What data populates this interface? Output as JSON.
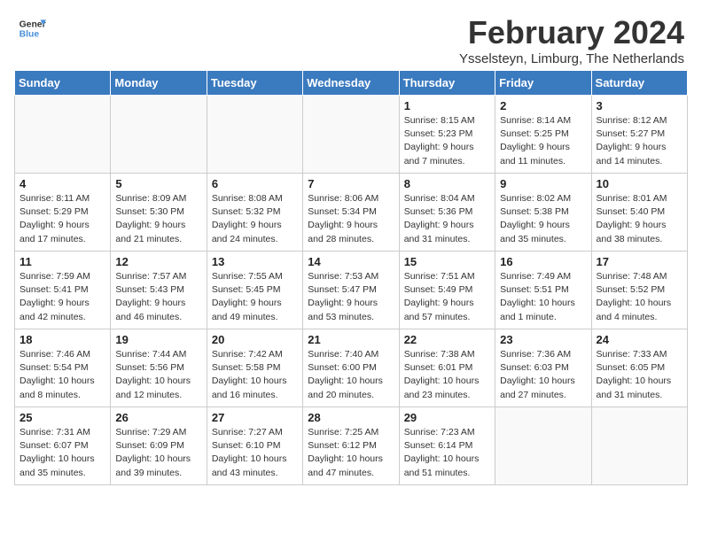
{
  "header": {
    "logo_general": "General",
    "logo_blue": "Blue",
    "month": "February 2024",
    "location": "Ysselsteyn, Limburg, The Netherlands"
  },
  "days_of_week": [
    "Sunday",
    "Monday",
    "Tuesday",
    "Wednesday",
    "Thursday",
    "Friday",
    "Saturday"
  ],
  "weeks": [
    [
      {
        "day": "",
        "info": ""
      },
      {
        "day": "",
        "info": ""
      },
      {
        "day": "",
        "info": ""
      },
      {
        "day": "",
        "info": ""
      },
      {
        "day": "1",
        "info": "Sunrise: 8:15 AM\nSunset: 5:23 PM\nDaylight: 9 hours\nand 7 minutes."
      },
      {
        "day": "2",
        "info": "Sunrise: 8:14 AM\nSunset: 5:25 PM\nDaylight: 9 hours\nand 11 minutes."
      },
      {
        "day": "3",
        "info": "Sunrise: 8:12 AM\nSunset: 5:27 PM\nDaylight: 9 hours\nand 14 minutes."
      }
    ],
    [
      {
        "day": "4",
        "info": "Sunrise: 8:11 AM\nSunset: 5:29 PM\nDaylight: 9 hours\nand 17 minutes."
      },
      {
        "day": "5",
        "info": "Sunrise: 8:09 AM\nSunset: 5:30 PM\nDaylight: 9 hours\nand 21 minutes."
      },
      {
        "day": "6",
        "info": "Sunrise: 8:08 AM\nSunset: 5:32 PM\nDaylight: 9 hours\nand 24 minutes."
      },
      {
        "day": "7",
        "info": "Sunrise: 8:06 AM\nSunset: 5:34 PM\nDaylight: 9 hours\nand 28 minutes."
      },
      {
        "day": "8",
        "info": "Sunrise: 8:04 AM\nSunset: 5:36 PM\nDaylight: 9 hours\nand 31 minutes."
      },
      {
        "day": "9",
        "info": "Sunrise: 8:02 AM\nSunset: 5:38 PM\nDaylight: 9 hours\nand 35 minutes."
      },
      {
        "day": "10",
        "info": "Sunrise: 8:01 AM\nSunset: 5:40 PM\nDaylight: 9 hours\nand 38 minutes."
      }
    ],
    [
      {
        "day": "11",
        "info": "Sunrise: 7:59 AM\nSunset: 5:41 PM\nDaylight: 9 hours\nand 42 minutes."
      },
      {
        "day": "12",
        "info": "Sunrise: 7:57 AM\nSunset: 5:43 PM\nDaylight: 9 hours\nand 46 minutes."
      },
      {
        "day": "13",
        "info": "Sunrise: 7:55 AM\nSunset: 5:45 PM\nDaylight: 9 hours\nand 49 minutes."
      },
      {
        "day": "14",
        "info": "Sunrise: 7:53 AM\nSunset: 5:47 PM\nDaylight: 9 hours\nand 53 minutes."
      },
      {
        "day": "15",
        "info": "Sunrise: 7:51 AM\nSunset: 5:49 PM\nDaylight: 9 hours\nand 57 minutes."
      },
      {
        "day": "16",
        "info": "Sunrise: 7:49 AM\nSunset: 5:51 PM\nDaylight: 10 hours\nand 1 minute."
      },
      {
        "day": "17",
        "info": "Sunrise: 7:48 AM\nSunset: 5:52 PM\nDaylight: 10 hours\nand 4 minutes."
      }
    ],
    [
      {
        "day": "18",
        "info": "Sunrise: 7:46 AM\nSunset: 5:54 PM\nDaylight: 10 hours\nand 8 minutes."
      },
      {
        "day": "19",
        "info": "Sunrise: 7:44 AM\nSunset: 5:56 PM\nDaylight: 10 hours\nand 12 minutes."
      },
      {
        "day": "20",
        "info": "Sunrise: 7:42 AM\nSunset: 5:58 PM\nDaylight: 10 hours\nand 16 minutes."
      },
      {
        "day": "21",
        "info": "Sunrise: 7:40 AM\nSunset: 6:00 PM\nDaylight: 10 hours\nand 20 minutes."
      },
      {
        "day": "22",
        "info": "Sunrise: 7:38 AM\nSunset: 6:01 PM\nDaylight: 10 hours\nand 23 minutes."
      },
      {
        "day": "23",
        "info": "Sunrise: 7:36 AM\nSunset: 6:03 PM\nDaylight: 10 hours\nand 27 minutes."
      },
      {
        "day": "24",
        "info": "Sunrise: 7:33 AM\nSunset: 6:05 PM\nDaylight: 10 hours\nand 31 minutes."
      }
    ],
    [
      {
        "day": "25",
        "info": "Sunrise: 7:31 AM\nSunset: 6:07 PM\nDaylight: 10 hours\nand 35 minutes."
      },
      {
        "day": "26",
        "info": "Sunrise: 7:29 AM\nSunset: 6:09 PM\nDaylight: 10 hours\nand 39 minutes."
      },
      {
        "day": "27",
        "info": "Sunrise: 7:27 AM\nSunset: 6:10 PM\nDaylight: 10 hours\nand 43 minutes."
      },
      {
        "day": "28",
        "info": "Sunrise: 7:25 AM\nSunset: 6:12 PM\nDaylight: 10 hours\nand 47 minutes."
      },
      {
        "day": "29",
        "info": "Sunrise: 7:23 AM\nSunset: 6:14 PM\nDaylight: 10 hours\nand 51 minutes."
      },
      {
        "day": "",
        "info": ""
      },
      {
        "day": "",
        "info": ""
      }
    ]
  ]
}
